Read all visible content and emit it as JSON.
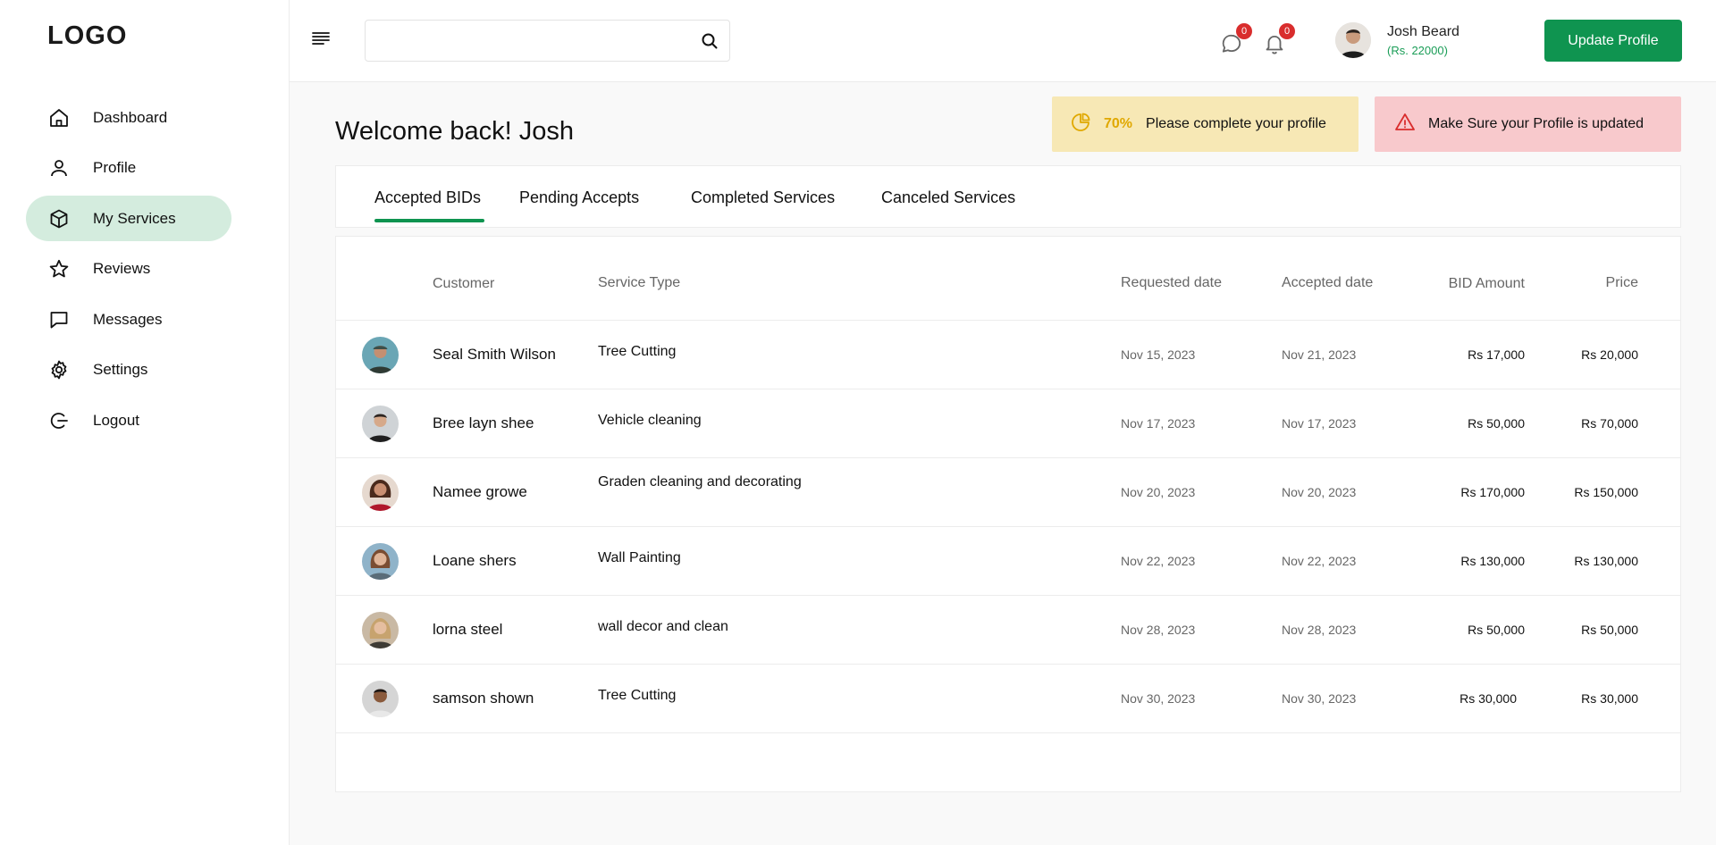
{
  "logo": "LOGO",
  "sidebar": {
    "items": [
      {
        "label": "Dashboard",
        "icon": "home-icon"
      },
      {
        "label": "Profile",
        "icon": "user-icon"
      },
      {
        "label": "My Services",
        "icon": "box-icon",
        "active": true
      },
      {
        "label": "Reviews",
        "icon": "star-icon"
      },
      {
        "label": "Messages",
        "icon": "message-icon"
      },
      {
        "label": "Settings",
        "icon": "gear-icon"
      },
      {
        "label": "Logout",
        "icon": "logout-icon"
      }
    ]
  },
  "header": {
    "search_placeholder": "",
    "messages_badge": "0",
    "notifications_badge": "0",
    "user_name": "Josh Beard",
    "user_balance": "(Rs. 22000)",
    "update_button": "Update Profile"
  },
  "welcome": "Welcome back! Josh",
  "alerts": {
    "profile_progress": "70%",
    "profile_progress_text": "Please complete your profile",
    "warning_text": "Make Sure your Profile is updated"
  },
  "tabs": [
    {
      "label": "Accepted BIDs",
      "active": true
    },
    {
      "label": "Pending Accepts"
    },
    {
      "label": "Completed Services"
    },
    {
      "label": "Canceled Services"
    }
  ],
  "table": {
    "headers": {
      "customer": "Customer",
      "service_type": "Service Type",
      "requested_date": "Requested date",
      "accepted_date": "Accepted date",
      "bid_amount": "BID Amount",
      "price": "Price"
    },
    "rows": [
      {
        "customer": "Seal Smith Wilson",
        "service_type": "Tree Cutting",
        "requested": "Nov  15, 2023",
        "accepted": "Nov 21, 2023",
        "bid": "Rs 17,000",
        "price": "Rs 20,000"
      },
      {
        "customer": "Bree layn shee",
        "service_type": "Vehicle cleaning",
        "requested": "Nov  17, 2023",
        "accepted": "Nov  17, 2023",
        "bid": "Rs 50,000",
        "price": "Rs 70,000"
      },
      {
        "customer": "Namee growe",
        "service_type": "Graden cleaning and decorating",
        "requested": "Nov  20, 2023",
        "accepted": "Nov  20, 2023",
        "bid": "Rs 170,000",
        "price": "Rs 150,000"
      },
      {
        "customer": "Loane shers",
        "service_type": "Wall Painting",
        "requested": "Nov  22, 2023",
        "accepted": "Nov  22, 2023",
        "bid": "Rs 130,000",
        "price": "Rs 130,000"
      },
      {
        "customer": "lorna steel",
        "service_type": "wall decor and clean",
        "requested": "Nov  28, 2023",
        "accepted": "Nov  28, 2023",
        "bid": "Rs 50,000",
        "price": "Rs 50,000"
      },
      {
        "customer": "samson shown",
        "service_type": "Tree Cutting",
        "requested": "Nov  30, 2023",
        "accepted": "Nov  30, 2023",
        "bid": "Rs 30,000",
        "price": "Rs 30,000"
      }
    ]
  },
  "colors": {
    "accent": "#0f9450",
    "active_nav": "#d4ecde",
    "warning_bg": "#f7e8b5",
    "danger_bg": "#f8c9cc",
    "badge": "#d92d2d"
  }
}
